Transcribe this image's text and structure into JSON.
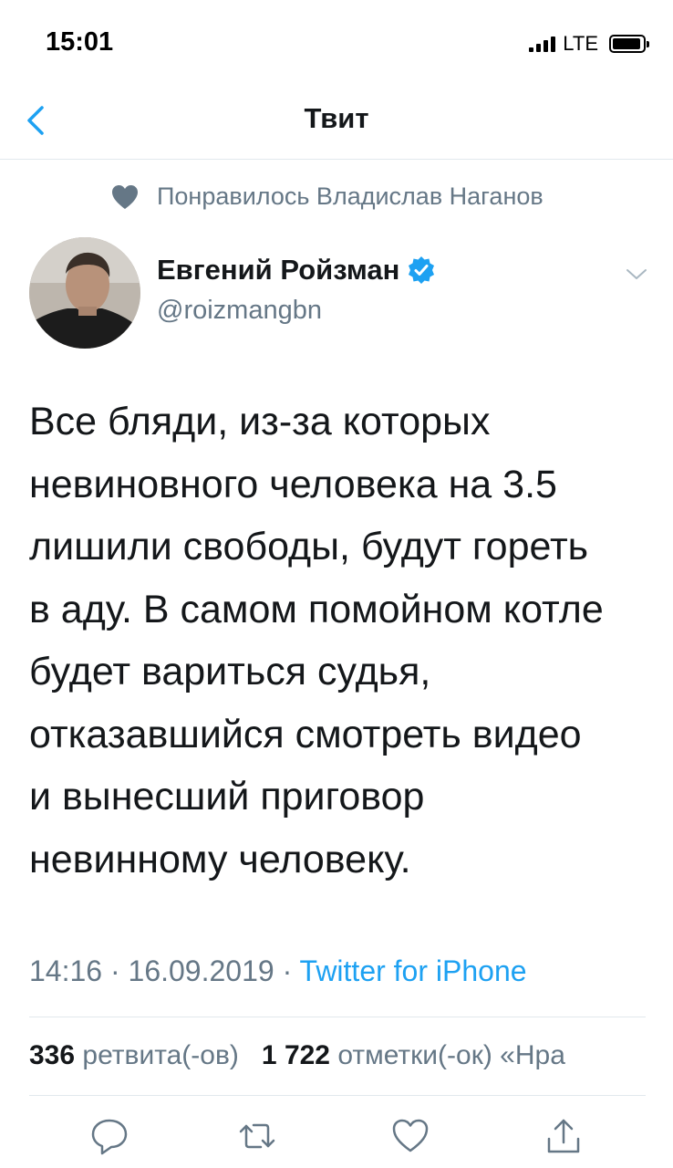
{
  "status_bar": {
    "time": "15:01",
    "network": "LTE",
    "signal_bars": 4,
    "battery_level": 0.8
  },
  "nav": {
    "title": "Твит"
  },
  "liked_by": "Понравилось Владислав Наганов",
  "author": {
    "name": "Евгений Ройзман",
    "handle": "@roizmangbn",
    "verified": true
  },
  "tweet": {
    "text": "Все бляди, из-за которых\nневиновного человека на 3.5\nлишили свободы, будут гореть\nв аду. В самом помойном котле\nбудет вариться судья,\nотказавшийся смотреть видео\nи вынесший приговор\nневинному человеку.",
    "time": "14:16",
    "sep1": "·",
    "date": "16.09.2019",
    "sep2": "·",
    "source": "Twitter for iPhone"
  },
  "stats": {
    "retweets_count": "336",
    "retweets_label": "ретвита(-ов)",
    "likes_count": "1 722",
    "likes_label": "отметки(-ок) «Нра"
  },
  "colors": {
    "accent": "#1da1f2",
    "secondary_text": "#657786",
    "primary_text": "#14171a",
    "divider": "#e1e8ed"
  },
  "icons": {
    "back": "chevron-left-icon",
    "liked": "heart-icon",
    "verified": "verified-badge-icon",
    "caret": "chevron-down-icon",
    "reply": "reply-icon",
    "retweet": "retweet-icon",
    "like": "heart-outline-icon",
    "share": "share-icon"
  }
}
